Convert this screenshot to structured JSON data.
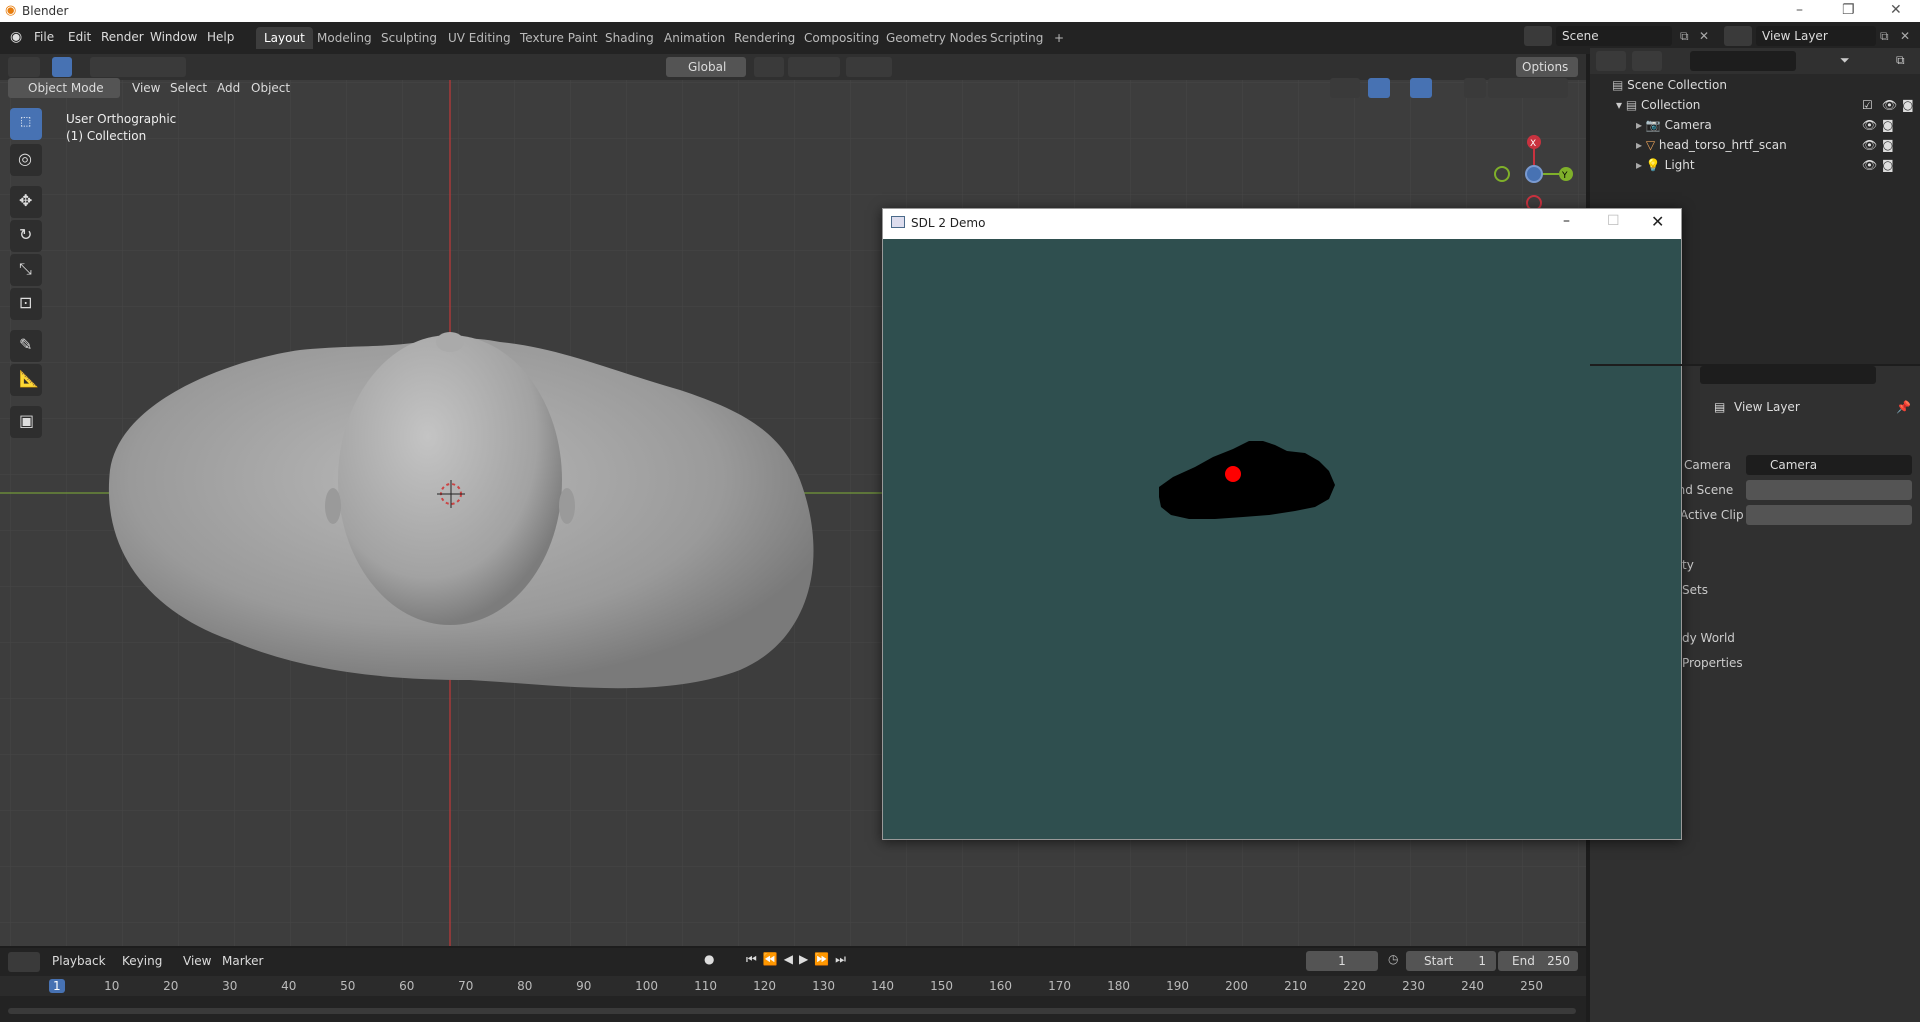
{
  "window": {
    "title": "Blender"
  },
  "menus": [
    "File",
    "Edit",
    "Render",
    "Window",
    "Help"
  ],
  "workspace_tabs": [
    "Layout",
    "Modeling",
    "Sculpting",
    "UV Editing",
    "Texture Paint",
    "Shading",
    "Animation",
    "Rendering",
    "Compositing",
    "Geometry Nodes",
    "Scripting",
    "+"
  ],
  "scene": {
    "name": "Scene",
    "view_layer": "View Layer"
  },
  "viewport_header": {
    "mode": "Object Mode",
    "menus": [
      "View",
      "Select",
      "Add",
      "Object"
    ],
    "orientation": "Global",
    "options": "Options"
  },
  "viewport": {
    "view_name": "User Orthographic",
    "collection": "(1) Collection"
  },
  "gizmo": {
    "x": "X",
    "y": "Y"
  },
  "outliner": {
    "root": "Scene Collection",
    "collection": "Collection",
    "items": [
      {
        "label": "Camera",
        "icon": "camera-icon"
      },
      {
        "label": "head_torso_hrtf_scan",
        "icon": "mesh-icon"
      },
      {
        "label": "Light",
        "icon": "light-icon"
      }
    ]
  },
  "properties": {
    "title": "View Layer",
    "fields": [
      {
        "label": "Camera",
        "value": "Camera"
      },
      {
        "label": "und Scene",
        "value": ""
      },
      {
        "label": "Active Clip",
        "value": ""
      }
    ],
    "panels": [
      "ty",
      "Sets",
      "dy World",
      "Properties"
    ]
  },
  "sdl_window": {
    "title": "SDL 2 Demo",
    "bg_color": "#2f4f4f"
  },
  "timeline": {
    "menus": [
      "Playback",
      "Keying",
      "View",
      "Marker"
    ],
    "current_frame": "1",
    "start_label": "Start",
    "start_value": "1",
    "end_label": "End",
    "end_value": "250",
    "ruler": [
      "1",
      "10",
      "20",
      "30",
      "40",
      "50",
      "60",
      "70",
      "80",
      "90",
      "100",
      "110",
      "120",
      "130",
      "140",
      "150",
      "160",
      "170",
      "180",
      "190",
      "200",
      "210",
      "220",
      "230",
      "240",
      "250"
    ]
  },
  "colors": {
    "accent": "#4772b3",
    "x_axis": "#c8323f",
    "y_axis": "#7fb02a"
  }
}
